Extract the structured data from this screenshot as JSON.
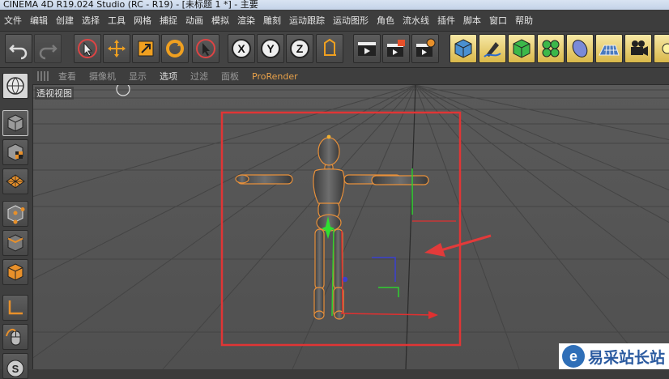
{
  "window": {
    "title": "CINEMA 4D R19.024 Studio (RC - R19) - [未标题 1 *] - 主要"
  },
  "menu": {
    "items": [
      "文件",
      "编辑",
      "创建",
      "选择",
      "工具",
      "网格",
      "捕捉",
      "动画",
      "模拟",
      "渲染",
      "雕刻",
      "运动跟踪",
      "运动图形",
      "角色",
      "流水线",
      "插件",
      "脚本",
      "窗口",
      "帮助"
    ]
  },
  "toolbar": {
    "tools": [
      {
        "icon": "undo-icon"
      },
      {
        "icon": "redo-icon"
      },
      {
        "icon": "live-selection-icon"
      },
      {
        "icon": "move-icon"
      },
      {
        "icon": "scale-icon"
      },
      {
        "icon": "rotate-icon"
      },
      {
        "icon": "recent-tool-icon"
      },
      {
        "icon": "x-axis-lock-icon",
        "label": "X"
      },
      {
        "icon": "y-axis-lock-icon",
        "label": "Y"
      },
      {
        "icon": "z-axis-lock-icon",
        "label": "Z"
      },
      {
        "icon": "coordinate-system-icon"
      },
      {
        "icon": "render-view-icon"
      },
      {
        "icon": "render-to-picture-viewer-icon"
      },
      {
        "icon": "render-settings-icon"
      },
      {
        "icon": "cube-icon"
      },
      {
        "icon": "pen-icon"
      },
      {
        "icon": "subdivision-icon"
      },
      {
        "icon": "cloner-icon"
      },
      {
        "icon": "deformer-icon"
      },
      {
        "icon": "floor-icon"
      },
      {
        "icon": "camera-icon"
      },
      {
        "icon": "light-icon"
      }
    ]
  },
  "viewbar": {
    "items": [
      "查看",
      "摄像机",
      "显示",
      "选项",
      "过滤",
      "面板",
      "ProRender"
    ]
  },
  "viewport": {
    "label": "透视视图"
  },
  "colors": {
    "highlight_box": "#e03535",
    "annotation_arrow": "#e23a3a",
    "figure_outline": "#e8903a",
    "accent": "#e9a24a"
  },
  "watermark": {
    "logo": "e",
    "text": "易采站长站"
  }
}
